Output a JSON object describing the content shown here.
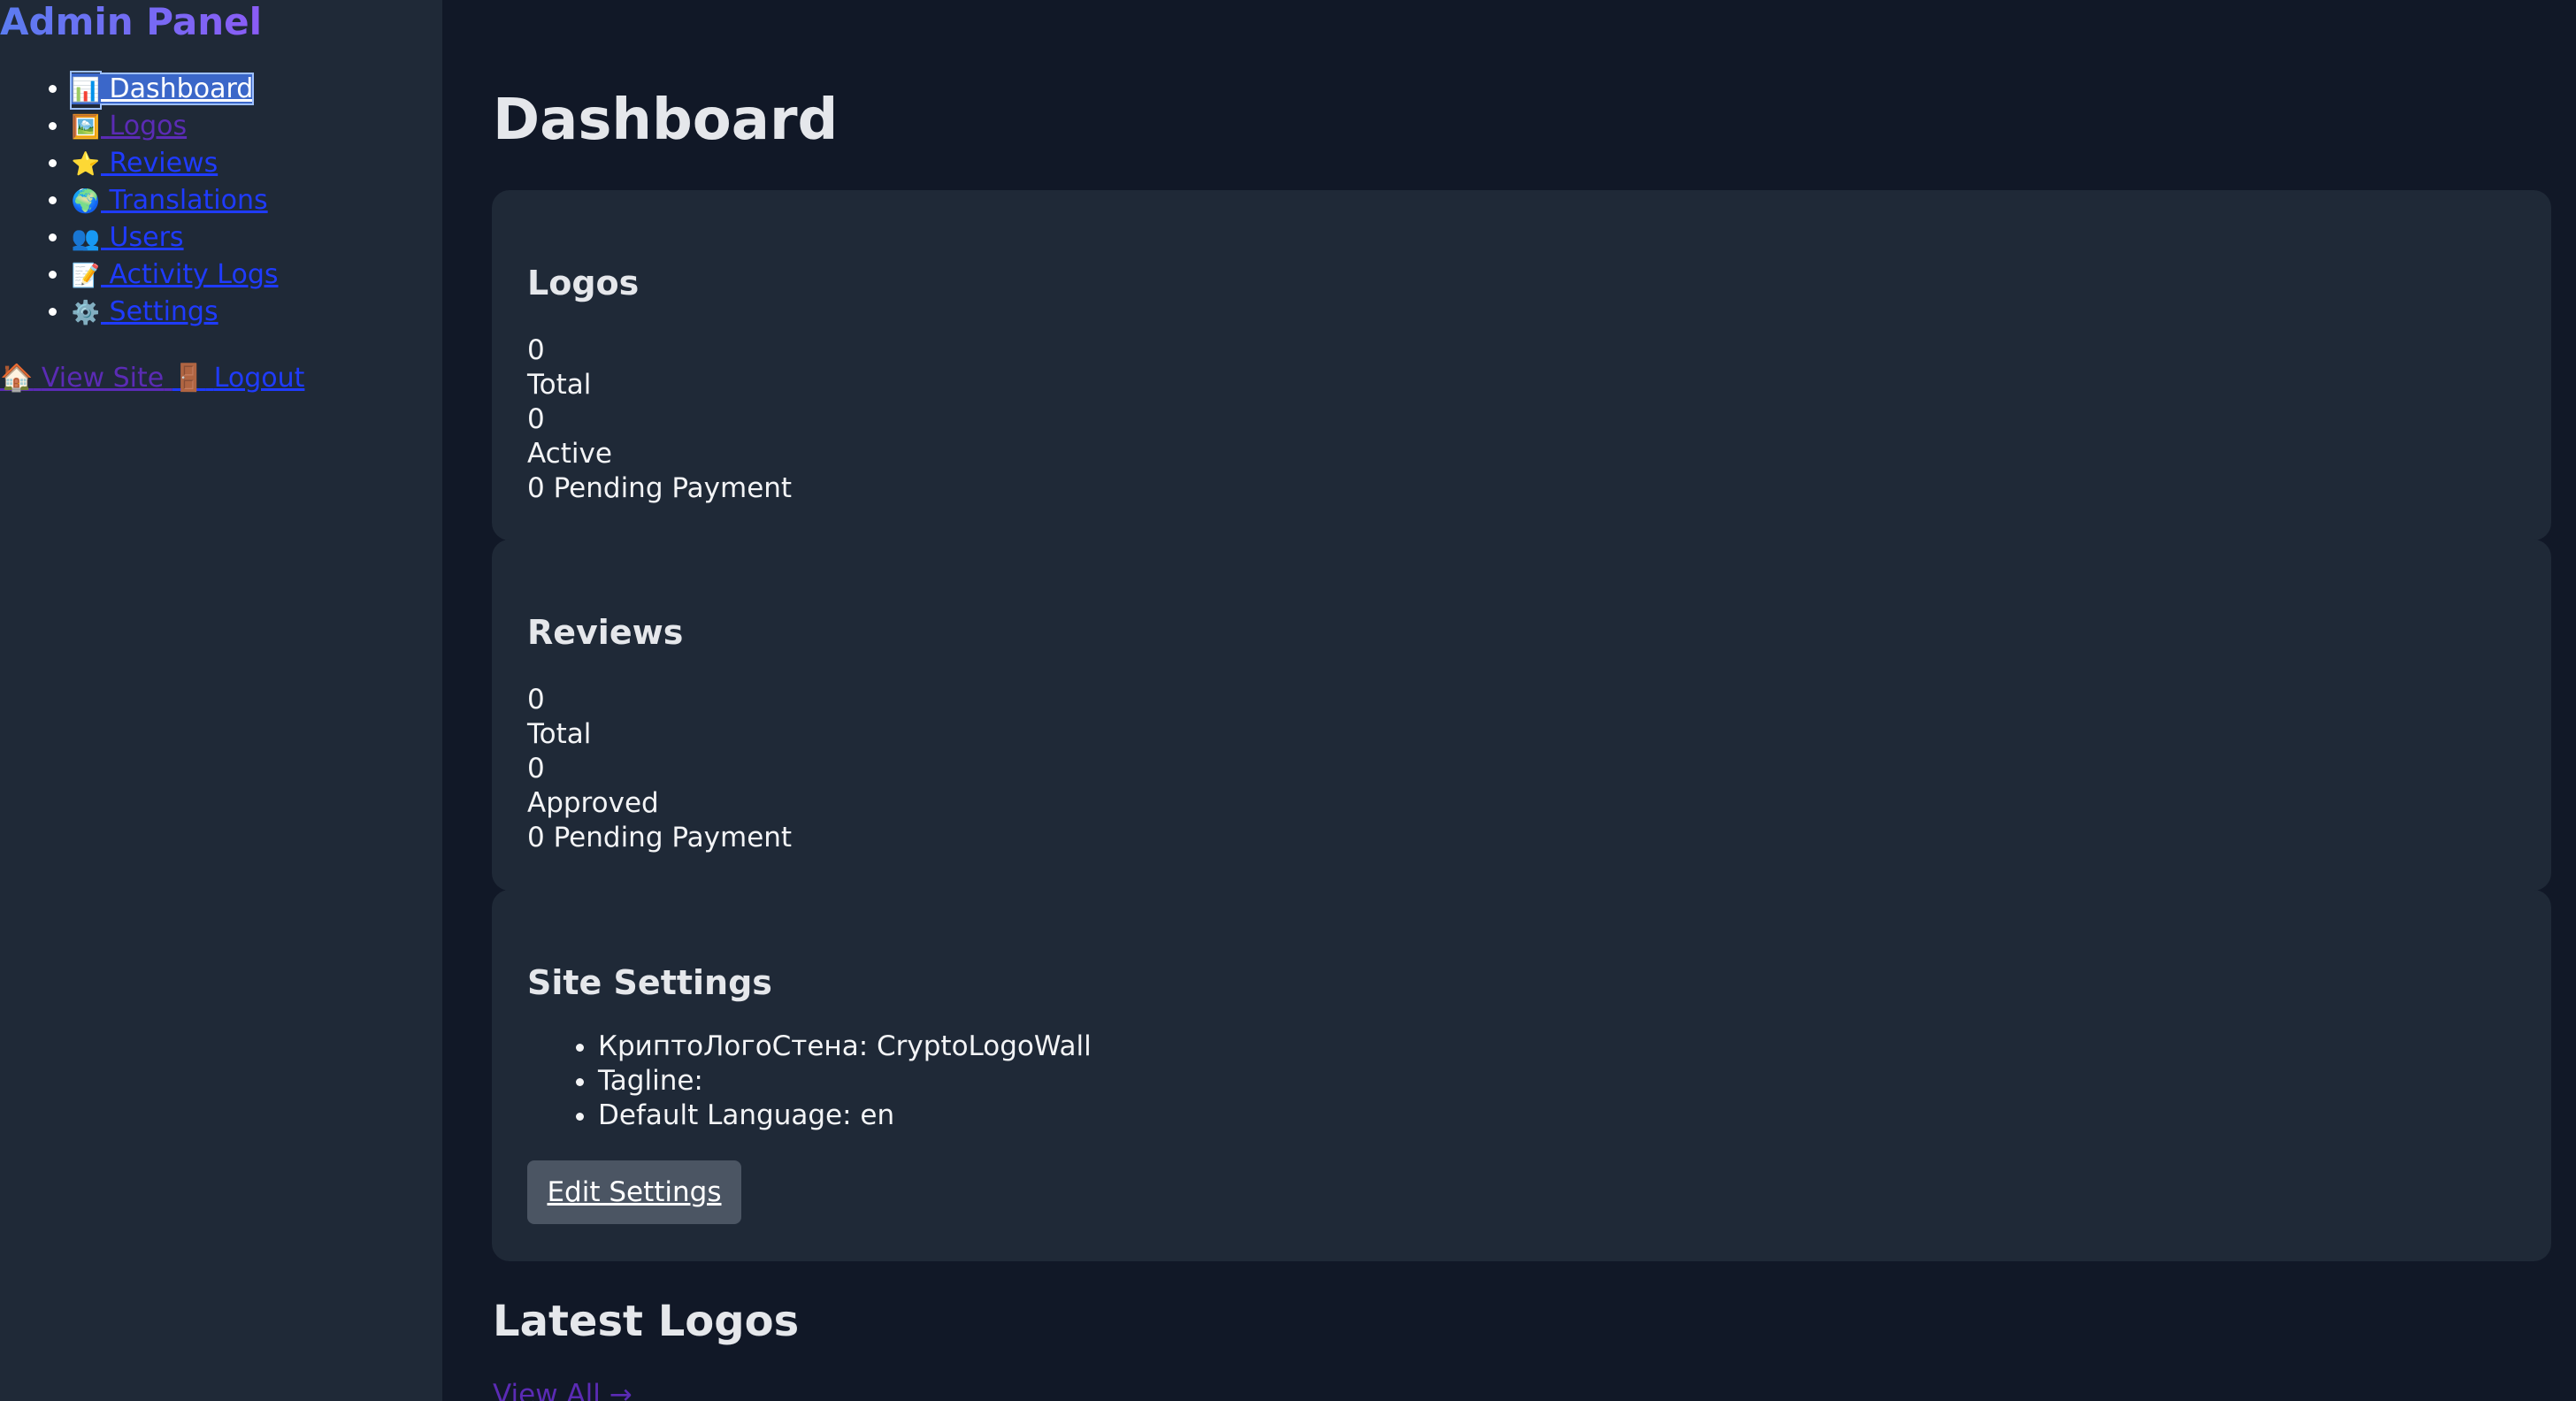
{
  "sidebar": {
    "title": "Admin Panel",
    "items": [
      {
        "icon": "📊",
        "icon_name": "bar-chart-icon",
        "label": "Dashboard"
      },
      {
        "icon": "🖼️",
        "icon_name": "framed-picture-icon",
        "label": "Logos"
      },
      {
        "icon": "⭐",
        "icon_name": "star-icon",
        "label": "Reviews"
      },
      {
        "icon": "🌍",
        "icon_name": "globe-icon",
        "label": "Translations"
      },
      {
        "icon": "👥",
        "icon_name": "users-icon",
        "label": "Users"
      },
      {
        "icon": "📝",
        "icon_name": "memo-icon",
        "label": "Activity Logs"
      },
      {
        "icon": "⚙️",
        "icon_name": "gear-icon",
        "label": "Settings"
      }
    ],
    "footer": {
      "view_site_icon": "🏠",
      "view_site_label": "View Site",
      "logout_icon": "🚪",
      "logout_label": "Logout"
    }
  },
  "main": {
    "title": "Dashboard",
    "logos_card": {
      "title": "Logos",
      "total_value": "0",
      "total_label": "Total",
      "active_value": "0",
      "active_label": "Active",
      "pending": "0 Pending Payment"
    },
    "reviews_card": {
      "title": "Reviews",
      "total_value": "0",
      "total_label": "Total",
      "approved_value": "0",
      "approved_label": "Approved",
      "pending": "0 Pending Payment"
    },
    "settings_card": {
      "title": "Site Settings",
      "items": [
        "КриптоЛогоСтена: CryptoLogoWall",
        "Tagline:",
        "Default Language: en"
      ],
      "edit_button": "Edit Settings"
    },
    "latest_logos": {
      "title": "Latest Logos",
      "view_all": "View All →"
    }
  },
  "colors": {
    "background": "#111827",
    "panel": "#1f2937",
    "accent": "#6366f1",
    "link": "#1f3bff",
    "visited_link": "#5b2bb5",
    "button": "#4b5563"
  }
}
